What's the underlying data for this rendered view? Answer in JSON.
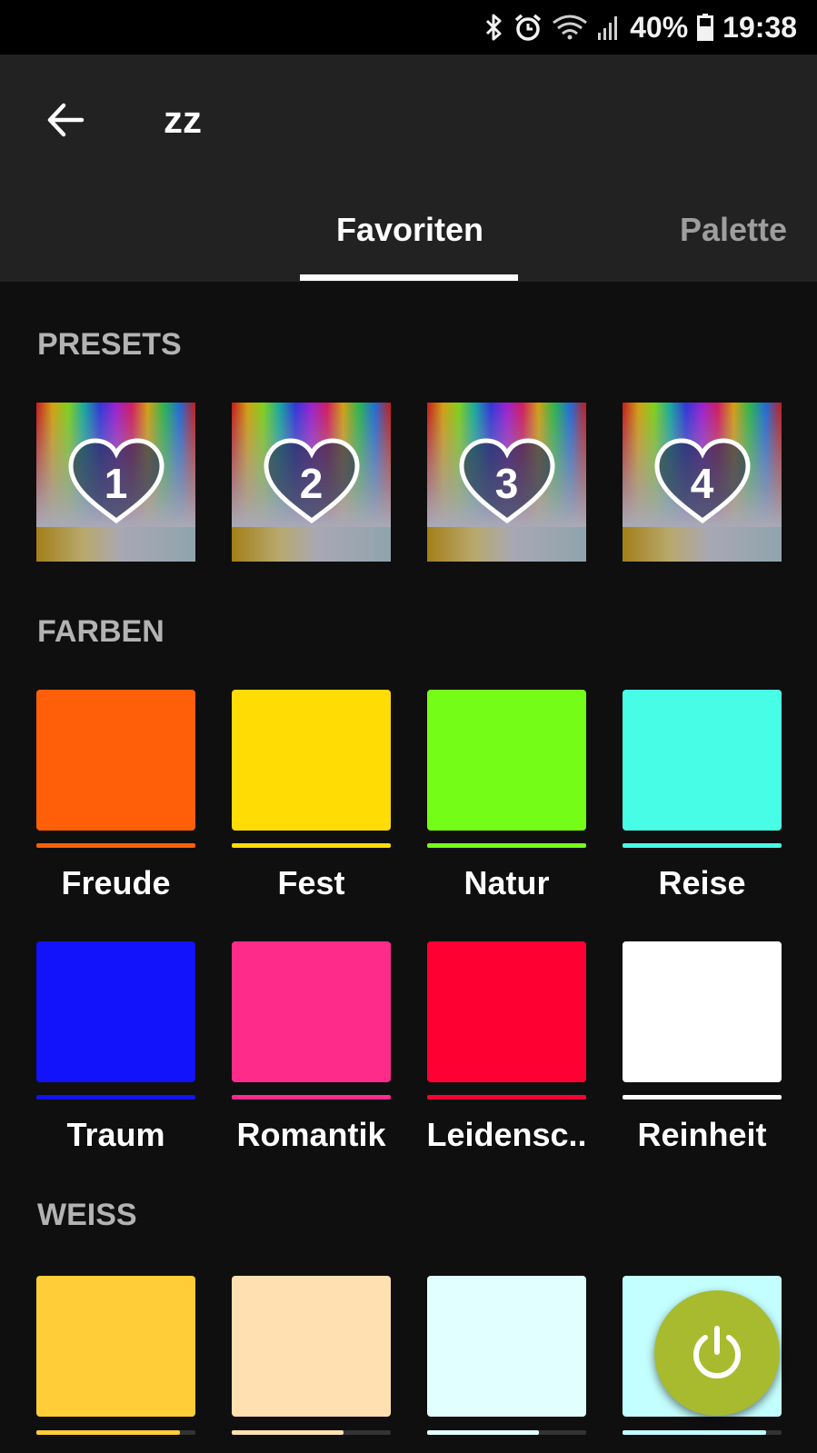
{
  "status_bar": {
    "battery_percent": "40%",
    "time": "19:38",
    "icons": [
      "bluetooth-icon",
      "alarm-icon",
      "wifi-icon",
      "signal-icon",
      "battery-icon"
    ]
  },
  "header": {
    "back_icon": "arrow-left-icon",
    "title": "zz"
  },
  "tabs": [
    {
      "label": "Favoriten",
      "active": true
    },
    {
      "label": "Palette",
      "active": false
    }
  ],
  "presets": {
    "title": "PRESETS",
    "items": [
      {
        "number": "1"
      },
      {
        "number": "2"
      },
      {
        "number": "3"
      },
      {
        "number": "4"
      }
    ]
  },
  "colors": {
    "title": "FARBEN",
    "items": [
      {
        "label": "Freude",
        "color": "#ff5f08"
      },
      {
        "label": "Fest",
        "color": "#ffdc04"
      },
      {
        "label": "Natur",
        "color": "#74fe17"
      },
      {
        "label": "Reise",
        "color": "#47fde6"
      },
      {
        "label": "Traum",
        "color": "#1212fb"
      },
      {
        "label": "Romantik",
        "color": "#ff2b8a"
      },
      {
        "label": "Leidensc..",
        "color": "#ff0032"
      },
      {
        "label": "Reinheit",
        "color": "#ffffff"
      }
    ]
  },
  "white": {
    "title": "WEISS",
    "items": [
      {
        "color": "#ffcd37",
        "bar_color": "#ffcd37",
        "level": 0.9
      },
      {
        "color": "#ffe0b1",
        "bar_color": "#ffe0b1",
        "level": 0.7
      },
      {
        "color": "#e1ffff",
        "bar_color": "#e1ffff",
        "level": 0.7
      },
      {
        "color": "#c4ffff",
        "bar_color": "#c4ffff",
        "level": 0.9
      }
    ]
  },
  "fab": {
    "icon": "power-icon",
    "color": "#a8bb2e"
  }
}
